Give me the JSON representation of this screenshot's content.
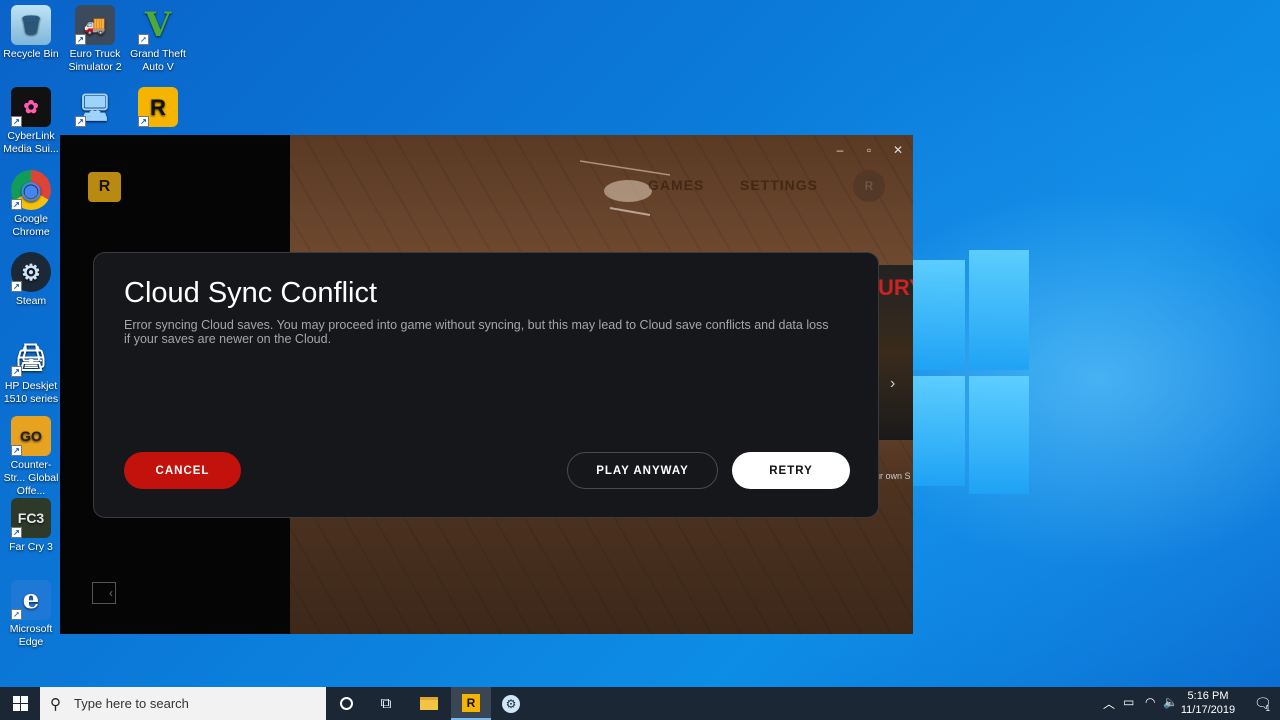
{
  "desktop": {
    "icons": [
      {
        "label": "Recycle Bin",
        "glyph": "🗑"
      },
      {
        "label": "Euro Truck Simulator 2",
        "glyph": "🚚"
      },
      {
        "label": "Grand Theft Auto V",
        "glyph": "V"
      },
      {
        "label": "CyberLink Media Sui...",
        "glyph": "✿"
      },
      {
        "label": "This PC",
        "glyph": "🖥"
      },
      {
        "label": "Rockstar",
        "glyph": "R"
      },
      {
        "label": "Google Chrome",
        "glyph": "◉"
      },
      {
        "label": "Steam",
        "glyph": "⚙"
      },
      {
        "label": "HP Deskjet 1510 series",
        "glyph": "🖨"
      },
      {
        "label": "Counter-Str... Global Offe...",
        "glyph": "GO"
      },
      {
        "label": "Far Cry 3",
        "glyph": "FC3"
      },
      {
        "label": "Microsoft Edge",
        "glyph": "e"
      }
    ]
  },
  "launcher": {
    "logo": "R",
    "nav_games": "GAMES",
    "nav_settings": "SETTINGS",
    "avatar": "R",
    "minimize": "–",
    "maximize": "▫",
    "close": "✕",
    "peek_title": "URY",
    "peek_text": "ur own S",
    "collapse": "‹"
  },
  "modal": {
    "title": "Cloud Sync Conflict",
    "body": "Error syncing Cloud saves. You may proceed into game without syncing, but this may lead to Cloud save conflicts and data loss if your saves are newer on the Cloud.",
    "cancel": "CANCEL",
    "play_anyway": "PLAY ANYWAY",
    "retry": "RETRY"
  },
  "taskbar": {
    "search_placeholder": "Type here to search",
    "time": "5:16 PM",
    "date": "11/17/2019",
    "notification_count": "1"
  },
  "colors": {
    "accent_red": "#c3120b",
    "modal_bg": "#16171b",
    "taskbar_bg": "#1b2734"
  }
}
